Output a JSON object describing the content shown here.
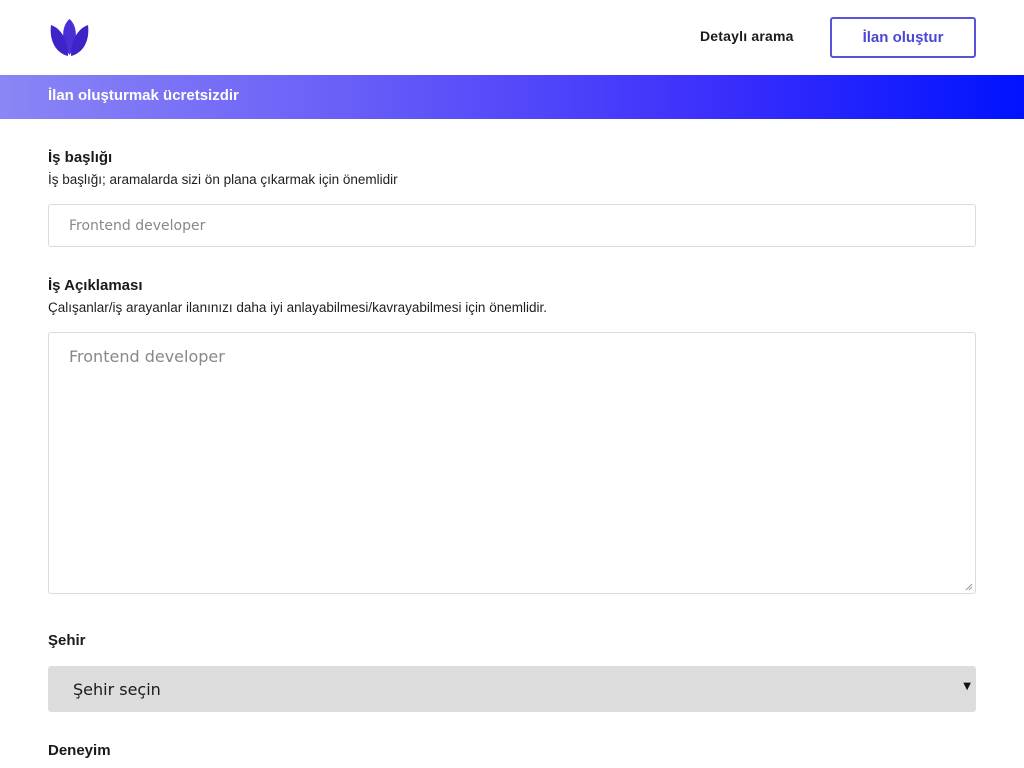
{
  "header": {
    "logo_icon": "lotus-logo-icon",
    "logo_color": "#4a2fd6",
    "nav_link": "Detaylı arama",
    "create_button": "İlan oluştur"
  },
  "banner": {
    "text": "İlan oluşturmak ücretsizdir",
    "gradient_start": "#8a86f6",
    "gradient_end": "#0012ff"
  },
  "form": {
    "title": {
      "label": "İş başlığı",
      "hint": "İş başlığı; aramalarda sizi ön plana çıkarmak için önemlidir",
      "placeholder": "Frontend developer",
      "value": ""
    },
    "description": {
      "label": "İş Açıklaması",
      "hint": "Çalışanlar/iş arayanlar ilanınızı daha iyi anlayabilmesi/kavrayabilmesi için önemlidir.",
      "placeholder": "Frontend developer",
      "value": ""
    },
    "city": {
      "label": "Şehir",
      "selected": "Şehir seçin"
    },
    "experience": {
      "label": "Deneyim"
    }
  },
  "accent_color": "#4b47d6"
}
